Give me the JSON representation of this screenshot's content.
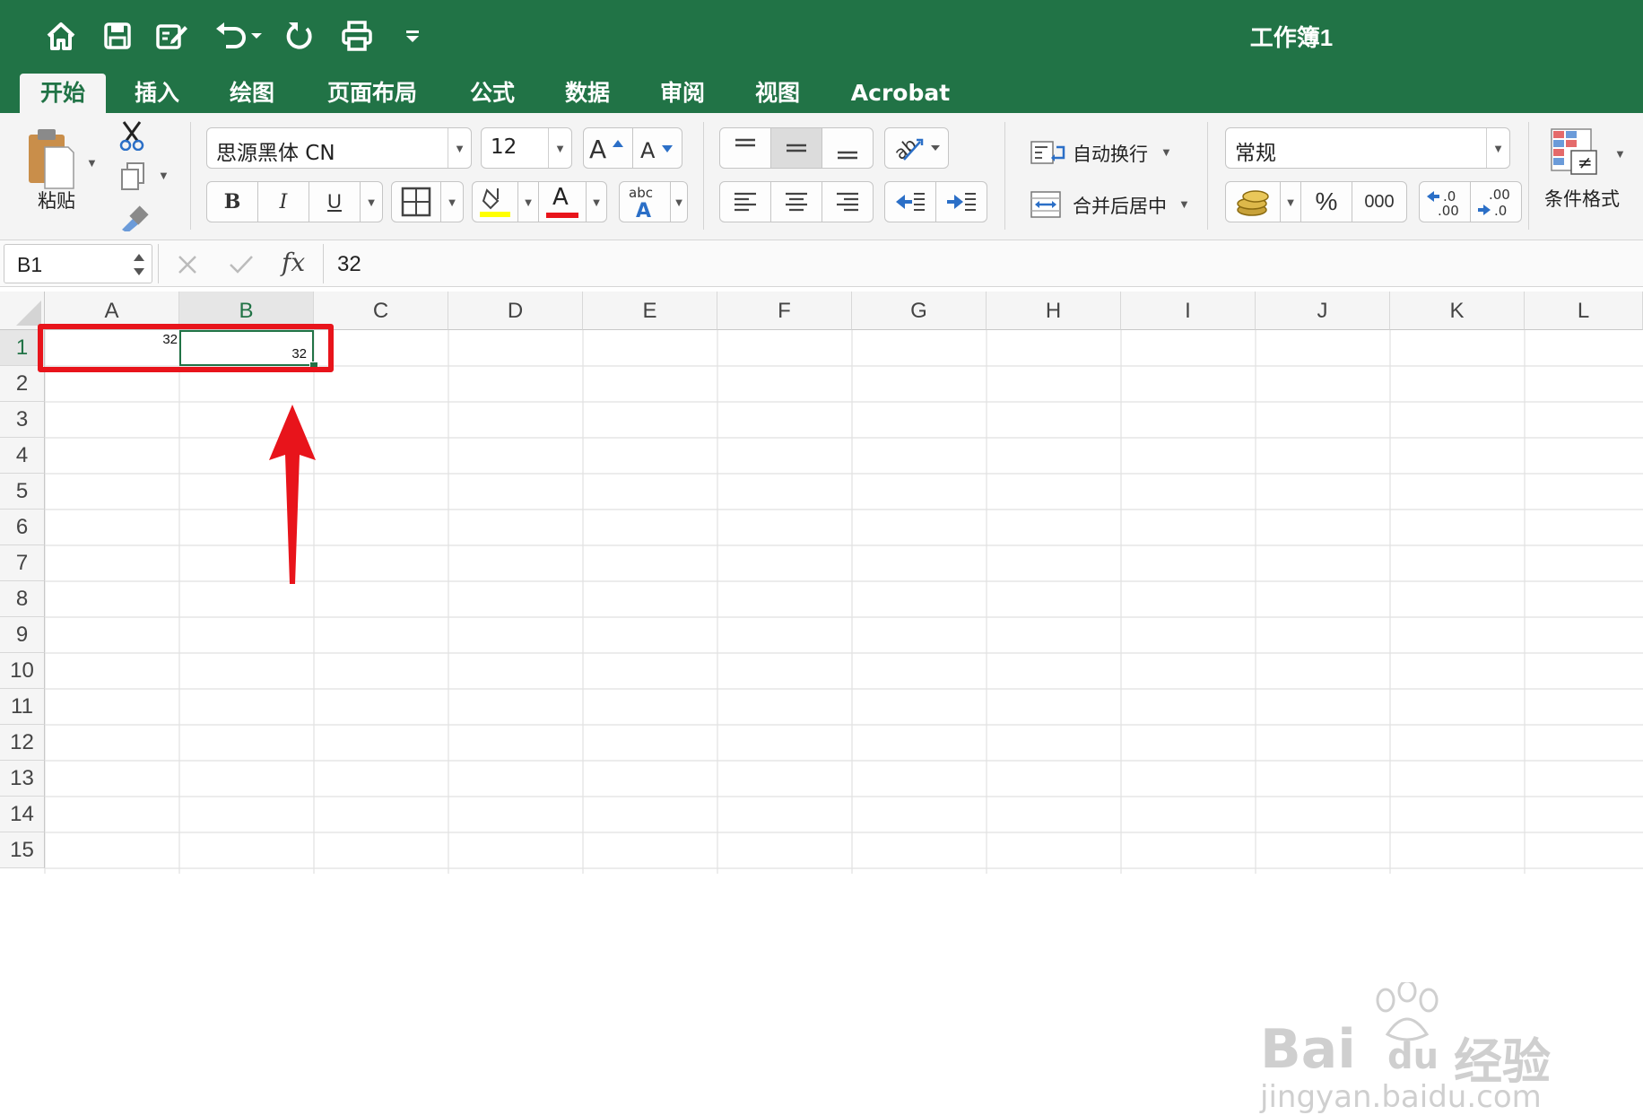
{
  "window": {
    "title": "工作簿1"
  },
  "quick_access": {
    "icons": [
      "home-icon",
      "save-icon",
      "edit-icon",
      "undo-icon",
      "redo-icon",
      "print-icon",
      "customize-icon"
    ]
  },
  "tabs": [
    {
      "label": "开始",
      "active": true
    },
    {
      "label": "插入"
    },
    {
      "label": "绘图"
    },
    {
      "label": "页面布局"
    },
    {
      "label": "公式"
    },
    {
      "label": "数据"
    },
    {
      "label": "审阅"
    },
    {
      "label": "视图"
    },
    {
      "label": "Acrobat"
    }
  ],
  "ribbon": {
    "paste_label": "粘贴",
    "font_name": "思源黑体 CN",
    "font_size": "12",
    "bold": "B",
    "italic": "I",
    "underline": "U",
    "font_color_glyph": "A",
    "wrap_text": "自动换行",
    "merge_center": "合并后居中",
    "number_format": "常规",
    "percent": "%",
    "thousands": "000",
    "conditional_format": "条件格式",
    "highlight_color": "#ffff00",
    "font_color": "#e8141b"
  },
  "formula_bar": {
    "name_box": "B1",
    "fx": "fx",
    "value": "32"
  },
  "sheet": {
    "columns": [
      "A",
      "B",
      "C",
      "D",
      "E",
      "F",
      "G",
      "H",
      "I",
      "J",
      "K",
      "L"
    ],
    "rows": [
      "1",
      "2",
      "3",
      "4",
      "5",
      "6",
      "7",
      "8",
      "9",
      "10",
      "11",
      "12",
      "13",
      "14",
      "15"
    ],
    "selected_cell": "B1",
    "cells": {
      "A1": "32",
      "B1": "32"
    }
  },
  "annotation": {
    "color": "#e8141b"
  },
  "watermark": {
    "brand": "Bai",
    "du": "du",
    "cn": "经验",
    "url": "jingyan.baidu.com"
  }
}
